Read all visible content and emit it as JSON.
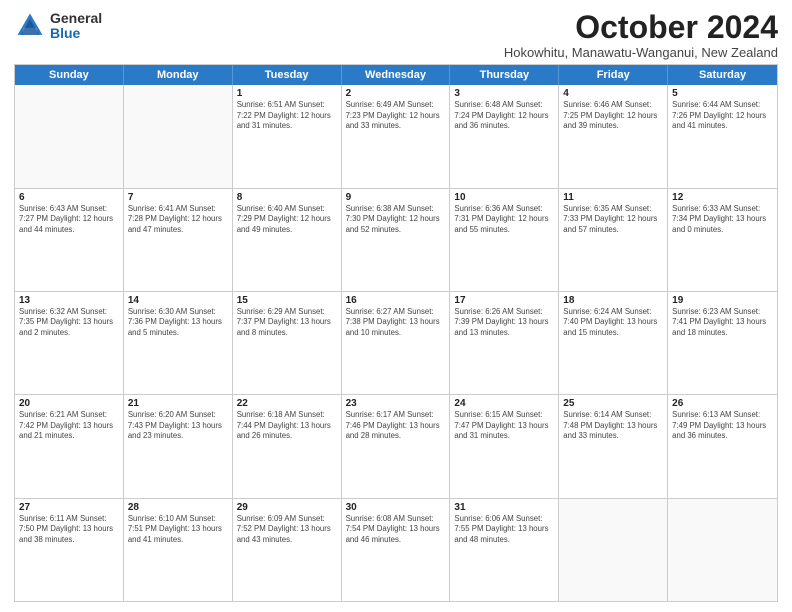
{
  "logo": {
    "general": "General",
    "blue": "Blue"
  },
  "title": "October 2024",
  "location": "Hokowhitu, Manawatu-Wanganui, New Zealand",
  "weekdays": [
    "Sunday",
    "Monday",
    "Tuesday",
    "Wednesday",
    "Thursday",
    "Friday",
    "Saturday"
  ],
  "rows": [
    [
      {
        "day": "",
        "info": ""
      },
      {
        "day": "",
        "info": ""
      },
      {
        "day": "1",
        "info": "Sunrise: 6:51 AM\nSunset: 7:22 PM\nDaylight: 12 hours and 31 minutes."
      },
      {
        "day": "2",
        "info": "Sunrise: 6:49 AM\nSunset: 7:23 PM\nDaylight: 12 hours and 33 minutes."
      },
      {
        "day": "3",
        "info": "Sunrise: 6:48 AM\nSunset: 7:24 PM\nDaylight: 12 hours and 36 minutes."
      },
      {
        "day": "4",
        "info": "Sunrise: 6:46 AM\nSunset: 7:25 PM\nDaylight: 12 hours and 39 minutes."
      },
      {
        "day": "5",
        "info": "Sunrise: 6:44 AM\nSunset: 7:26 PM\nDaylight: 12 hours and 41 minutes."
      }
    ],
    [
      {
        "day": "6",
        "info": "Sunrise: 6:43 AM\nSunset: 7:27 PM\nDaylight: 12 hours and 44 minutes."
      },
      {
        "day": "7",
        "info": "Sunrise: 6:41 AM\nSunset: 7:28 PM\nDaylight: 12 hours and 47 minutes."
      },
      {
        "day": "8",
        "info": "Sunrise: 6:40 AM\nSunset: 7:29 PM\nDaylight: 12 hours and 49 minutes."
      },
      {
        "day": "9",
        "info": "Sunrise: 6:38 AM\nSunset: 7:30 PM\nDaylight: 12 hours and 52 minutes."
      },
      {
        "day": "10",
        "info": "Sunrise: 6:36 AM\nSunset: 7:31 PM\nDaylight: 12 hours and 55 minutes."
      },
      {
        "day": "11",
        "info": "Sunrise: 6:35 AM\nSunset: 7:33 PM\nDaylight: 12 hours and 57 minutes."
      },
      {
        "day": "12",
        "info": "Sunrise: 6:33 AM\nSunset: 7:34 PM\nDaylight: 13 hours and 0 minutes."
      }
    ],
    [
      {
        "day": "13",
        "info": "Sunrise: 6:32 AM\nSunset: 7:35 PM\nDaylight: 13 hours and 2 minutes."
      },
      {
        "day": "14",
        "info": "Sunrise: 6:30 AM\nSunset: 7:36 PM\nDaylight: 13 hours and 5 minutes."
      },
      {
        "day": "15",
        "info": "Sunrise: 6:29 AM\nSunset: 7:37 PM\nDaylight: 13 hours and 8 minutes."
      },
      {
        "day": "16",
        "info": "Sunrise: 6:27 AM\nSunset: 7:38 PM\nDaylight: 13 hours and 10 minutes."
      },
      {
        "day": "17",
        "info": "Sunrise: 6:26 AM\nSunset: 7:39 PM\nDaylight: 13 hours and 13 minutes."
      },
      {
        "day": "18",
        "info": "Sunrise: 6:24 AM\nSunset: 7:40 PM\nDaylight: 13 hours and 15 minutes."
      },
      {
        "day": "19",
        "info": "Sunrise: 6:23 AM\nSunset: 7:41 PM\nDaylight: 13 hours and 18 minutes."
      }
    ],
    [
      {
        "day": "20",
        "info": "Sunrise: 6:21 AM\nSunset: 7:42 PM\nDaylight: 13 hours and 21 minutes."
      },
      {
        "day": "21",
        "info": "Sunrise: 6:20 AM\nSunset: 7:43 PM\nDaylight: 13 hours and 23 minutes."
      },
      {
        "day": "22",
        "info": "Sunrise: 6:18 AM\nSunset: 7:44 PM\nDaylight: 13 hours and 26 minutes."
      },
      {
        "day": "23",
        "info": "Sunrise: 6:17 AM\nSunset: 7:46 PM\nDaylight: 13 hours and 28 minutes."
      },
      {
        "day": "24",
        "info": "Sunrise: 6:15 AM\nSunset: 7:47 PM\nDaylight: 13 hours and 31 minutes."
      },
      {
        "day": "25",
        "info": "Sunrise: 6:14 AM\nSunset: 7:48 PM\nDaylight: 13 hours and 33 minutes."
      },
      {
        "day": "26",
        "info": "Sunrise: 6:13 AM\nSunset: 7:49 PM\nDaylight: 13 hours and 36 minutes."
      }
    ],
    [
      {
        "day": "27",
        "info": "Sunrise: 6:11 AM\nSunset: 7:50 PM\nDaylight: 13 hours and 38 minutes."
      },
      {
        "day": "28",
        "info": "Sunrise: 6:10 AM\nSunset: 7:51 PM\nDaylight: 13 hours and 41 minutes."
      },
      {
        "day": "29",
        "info": "Sunrise: 6:09 AM\nSunset: 7:52 PM\nDaylight: 13 hours and 43 minutes."
      },
      {
        "day": "30",
        "info": "Sunrise: 6:08 AM\nSunset: 7:54 PM\nDaylight: 13 hours and 46 minutes."
      },
      {
        "day": "31",
        "info": "Sunrise: 6:06 AM\nSunset: 7:55 PM\nDaylight: 13 hours and 48 minutes."
      },
      {
        "day": "",
        "info": ""
      },
      {
        "day": "",
        "info": ""
      }
    ]
  ]
}
